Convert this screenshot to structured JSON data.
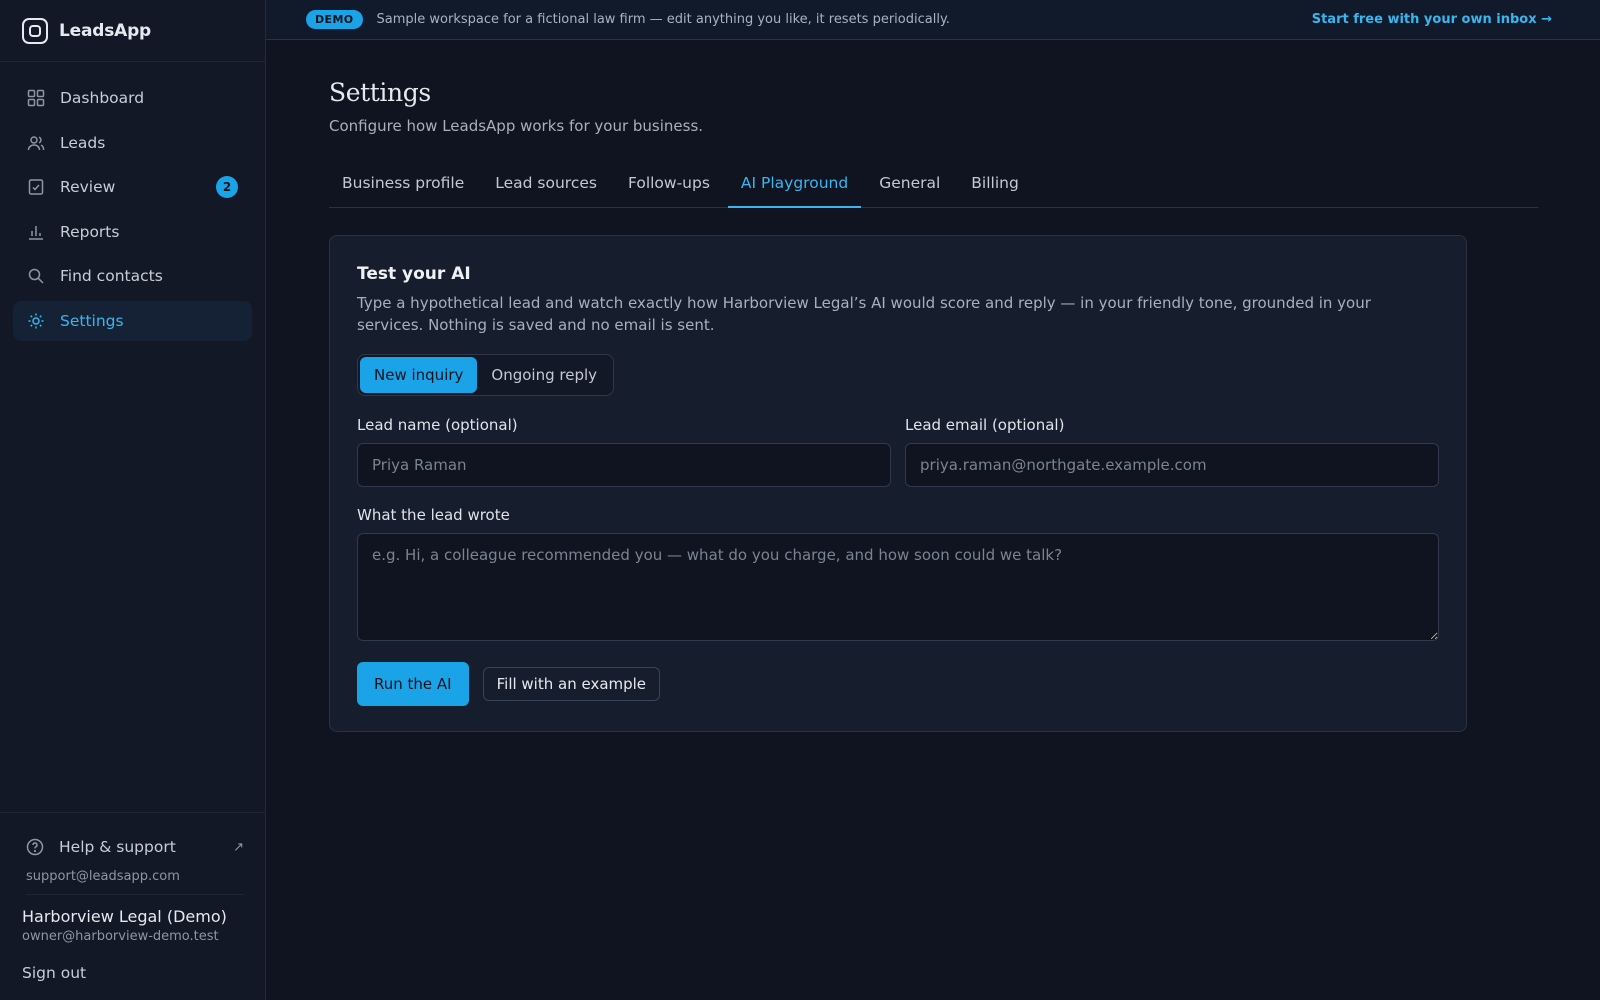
{
  "app": {
    "name": "LeadsApp"
  },
  "sidebar": {
    "items": [
      {
        "label": "Dashboard",
        "icon": "grid-icon"
      },
      {
        "label": "Leads",
        "icon": "users-icon"
      },
      {
        "label": "Review",
        "icon": "check-square-icon",
        "badge": "2"
      },
      {
        "label": "Reports",
        "icon": "bar-chart-icon"
      },
      {
        "label": "Find contacts",
        "icon": "search-icon"
      },
      {
        "label": "Settings",
        "icon": "gear-icon",
        "active": true
      }
    ],
    "help_label": "Help & support",
    "help_external": "↗",
    "support_email": "support@leadsapp.com",
    "org_name": "Harborview Legal (Demo)",
    "org_email": "owner@harborview-demo.test",
    "sign_out": "Sign out"
  },
  "banner": {
    "pill": "DEMO",
    "text": "Sample workspace for a fictional law firm — edit anything you like, it resets periodically.",
    "link": "Start free with your own inbox →"
  },
  "main": {
    "title": "Settings",
    "subtitle": "Configure how LeadsApp works for your business.",
    "tabs": [
      {
        "label": "Business profile"
      },
      {
        "label": "Lead sources"
      },
      {
        "label": "Follow-ups"
      },
      {
        "label": "AI Playground",
        "active": true
      },
      {
        "label": "General"
      },
      {
        "label": "Billing"
      }
    ]
  },
  "card": {
    "title": "Test your AI",
    "description": "Type a hypothetical lead and watch exactly how Harborview Legal’s AI would score and reply — in your friendly tone, grounded in your services. Nothing is saved and no email is sent.",
    "modes": {
      "new": "New inquiry",
      "ongoing": "Ongoing reply",
      "selected": "New inquiry"
    },
    "name_label": "Lead name (optional)",
    "name_placeholder": "Priya Raman",
    "email_label": "Lead email (optional)",
    "email_placeholder": "priya.raman@northgate.example.com",
    "wrote_label": "What the lead wrote",
    "wrote_placeholder": "e.g. Hi, a colleague recommended you — what do you charge, and how soon could we talk?",
    "run_button": "Run the AI",
    "example_button": "Fill with an example"
  },
  "colors": {
    "accent": "#1aa3e6",
    "accent_text": "#38b6ef",
    "background": "#0f1420",
    "sidebar": "#121826",
    "card": "#161d2c"
  }
}
